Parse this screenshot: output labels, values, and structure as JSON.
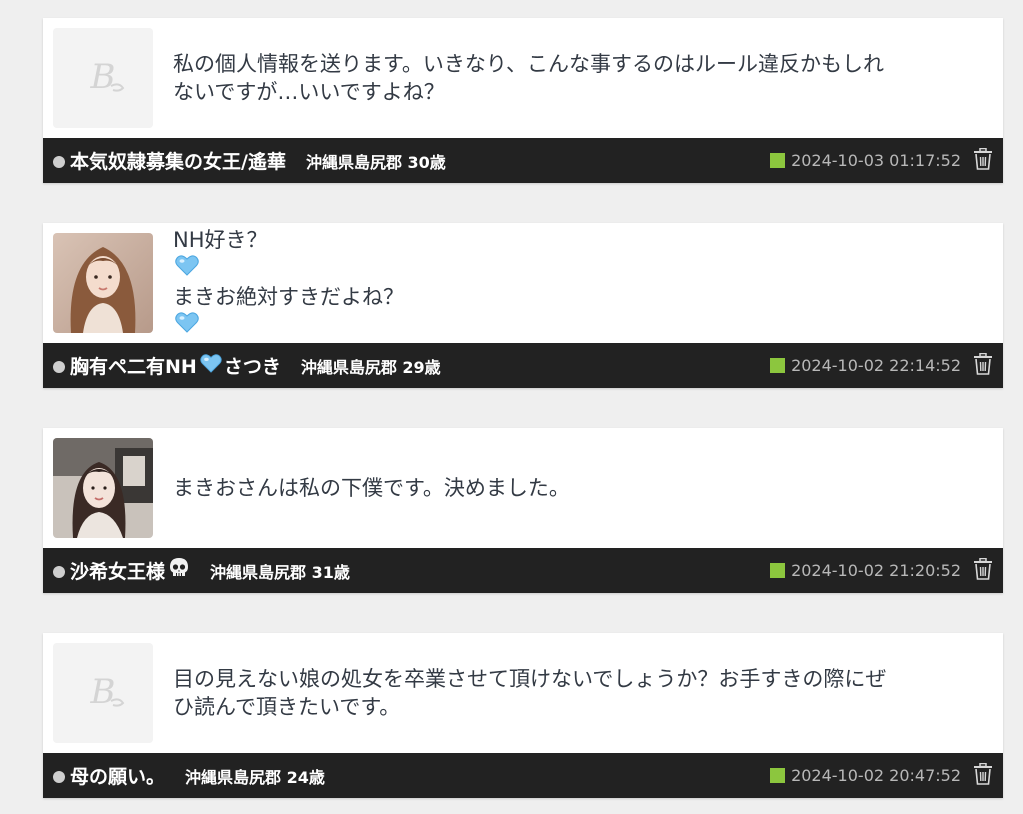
{
  "posts": [
    {
      "avatar": "placeholder-logo",
      "message_lines": [
        "私の個人情報を送ります。いきなり、こんな事するのはルール違反かもしれ",
        "ないですが…いいですよね？"
      ],
      "name": "本気奴隷募集の女王/遙華",
      "location": "沖縄県島尻郡 30歳",
      "timestamp": "2024-10-03 01:17:52"
    },
    {
      "avatar": "photo",
      "message_parts": [
        "NH好き？",
        "まきお絶対すきだよね？"
      ],
      "name_parts": [
        "胸有ペ二有NH",
        "さつき"
      ],
      "location": "沖縄県島尻郡 29歳",
      "timestamp": "2024-10-02 22:14:52"
    },
    {
      "avatar": "photo",
      "message_lines": [
        "まきおさんは私の下僕です。決めました。"
      ],
      "name": "沙希女王様",
      "location": "沖縄県島尻郡 31歳",
      "timestamp": "2024-10-02 21:20:52"
    },
    {
      "avatar": "placeholder-logo",
      "message_lines": [
        "目の見えない娘の処女を卒業させて頂けないでしょうか？お手すきの際にぜ",
        "ひ読んで頂きたいです。"
      ],
      "name": "母の願い。",
      "location": "沖縄県島尻郡 24歳",
      "timestamp": "2024-10-02 20:47:52"
    }
  ],
  "icons": {
    "status": "chat-bubble-icon",
    "date_marker": "green-square-icon",
    "delete": "trash-icon",
    "emoji_heart": "blue-heart-emoji",
    "emoji_skull": "skull-emoji"
  },
  "colors": {
    "footer_bg": "#222222",
    "date_marker": "#8cc63e",
    "timestamp": "#b8b8b8",
    "message": "#333a44",
    "heart": "#7cc5f2"
  }
}
